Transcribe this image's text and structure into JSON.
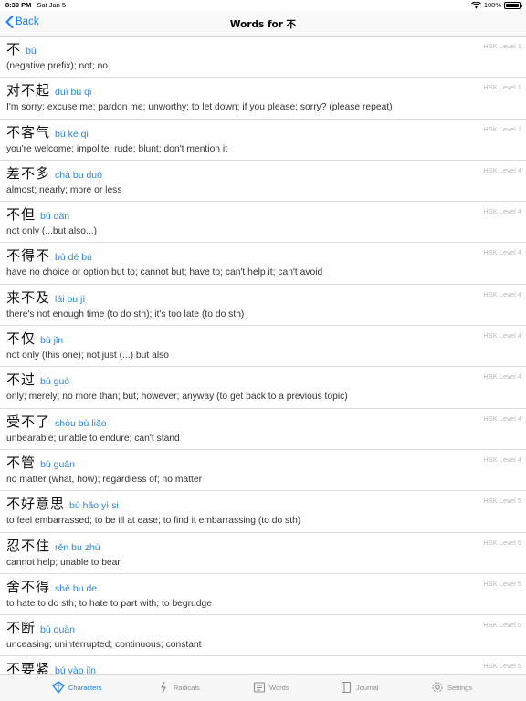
{
  "status_bar": {
    "time": "8:39 PM",
    "date": "Sat Jan 5",
    "battery": "100%",
    "battery_level": 1.0
  },
  "nav": {
    "back_label": "Back",
    "title": "Words for 不"
  },
  "words": [
    {
      "hanzi": "不",
      "pinyin": "bù",
      "level": "HSK Level 1",
      "definition": "(negative prefix); not; no"
    },
    {
      "hanzi": "对不起",
      "pinyin": "duì bu qǐ",
      "level": "HSK Level 1",
      "definition": "I'm sorry; excuse me; pardon me; unworthy; to let down; if you please; sorry? (please repeat)"
    },
    {
      "hanzi": "不客气",
      "pinyin": "bú kè qi",
      "level": "HSK Level 1",
      "definition": "you're welcome; impolite; rude; blunt; don't mention it"
    },
    {
      "hanzi": "差不多",
      "pinyin": "chà bu duō",
      "level": "HSK Level 4",
      "definition": "almost; nearly; more or less"
    },
    {
      "hanzi": "不但",
      "pinyin": "bú dàn",
      "level": "HSK Level 4",
      "definition": "not only (...but also...)"
    },
    {
      "hanzi": "不得不",
      "pinyin": "bù dé bù",
      "level": "HSK Level 4",
      "definition": "have no choice or option but to; cannot but; have to; can't help it; can't avoid"
    },
    {
      "hanzi": "来不及",
      "pinyin": "lái bu jí",
      "level": "HSK Level 4",
      "definition": "there's not enough time (to do sth); it's too late (to do sth)"
    },
    {
      "hanzi": "不仅",
      "pinyin": "bù jǐn",
      "level": "HSK Level 4",
      "definition": "not only (this one); not just (...) but also"
    },
    {
      "hanzi": "不过",
      "pinyin": "bú guò",
      "level": "HSK Level 4",
      "definition": "only; merely; no more than; but; however; anyway (to get back to a previous topic)"
    },
    {
      "hanzi": "受不了",
      "pinyin": "shòu bù liǎo",
      "level": "HSK Level 4",
      "definition": "unbearable; unable to endure; can't stand"
    },
    {
      "hanzi": "不管",
      "pinyin": "bù guǎn",
      "level": "HSK Level 4",
      "definition": "no matter (what, how); regardless of; no matter"
    },
    {
      "hanzi": "不好意思",
      "pinyin": "bù hǎo yì si",
      "level": "HSK Level 5",
      "definition": "to feel embarrassed; to be ill at ease; to find it embarrassing (to do sth)"
    },
    {
      "hanzi": "忍不住",
      "pinyin": "rěn bu zhù",
      "level": "HSK Level 5",
      "definition": "cannot help; unable to bear"
    },
    {
      "hanzi": "舍不得",
      "pinyin": "shě bu de",
      "level": "HSK Level 5",
      "definition": "to hate to do sth; to hate to part with; to begrudge"
    },
    {
      "hanzi": "不断",
      "pinyin": "bú duàn",
      "level": "HSK Level 5",
      "definition": "unceasing; uninterrupted; continuous; constant"
    },
    {
      "hanzi": "不要紧",
      "pinyin": "bú yào jǐn",
      "level": "HSK Level 5",
      "definition": ""
    }
  ],
  "tabs": [
    {
      "label": "Characters",
      "icon": "characters-icon",
      "active": true
    },
    {
      "label": "Radicals",
      "icon": "radicals-icon",
      "active": false
    },
    {
      "label": "Words",
      "icon": "words-icon",
      "active": false
    },
    {
      "label": "Journal",
      "icon": "journal-icon",
      "active": false
    },
    {
      "label": "Settings",
      "icon": "settings-icon",
      "active": false
    }
  ],
  "colors": {
    "accent": "#1a7ff0",
    "pinyin": "#2a86e0",
    "level": "#b8b8b8",
    "tab_inactive": "#8e8e8e"
  }
}
